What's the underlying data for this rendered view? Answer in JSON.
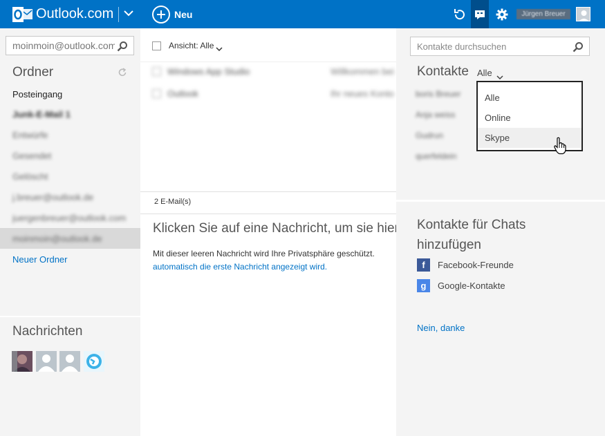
{
  "topbar": {
    "app_title": "Outlook.com",
    "new_label": "Neu",
    "user_name": "Jürgen Breuer",
    "icons": [
      "outlook-logo-icon",
      "chevron-down-icon",
      "plus-circle-icon",
      "undo-icon",
      "chat-icon",
      "gear-icon",
      "avatar"
    ],
    "colors": {
      "bar": "#0072c6",
      "active": "#004e8c"
    }
  },
  "left": {
    "search_value": "moinmoin@outlook.com",
    "folders_title": "Ordner",
    "folders": [
      {
        "label": "Posteingang"
      },
      {
        "label": "Junk-E-Mail 1"
      },
      {
        "label": "Entwürfe"
      },
      {
        "label": "Gesendet"
      },
      {
        "label": "Gelöscht"
      },
      {
        "label": "j.breuer@outlook.de"
      },
      {
        "label": "juergenbreuer@outlook.com"
      },
      {
        "label": "moinmoin@outlook.de"
      }
    ],
    "new_folder": "Neuer Ordner",
    "messages_title": "Nachrichten"
  },
  "middle": {
    "view_label": "Ansicht: Alle",
    "mails": [
      {
        "from": "Windows App Studio",
        "subject": "Willkommen bei"
      },
      {
        "from": "Outlook",
        "subject": "Ihr neues Konto"
      }
    ],
    "count": "2 E-Mail(s)",
    "headline": "Klicken Sie auf eine Nachricht, um sie hier anzuzeigen",
    "info_line1": "Mit dieser leeren Nachricht wird Ihre Privatsphäre geschützt.",
    "info_link": "automatisch die erste Nachricht angezeigt wird."
  },
  "right": {
    "search_placeholder": "Kontakte durchsuchen",
    "contacts_title": "Kontakte",
    "filter_label": "Alle",
    "contacts": [
      "boris Breuer",
      "Anja weiss",
      "Gudrun",
      "querfeldein"
    ],
    "filter_options": [
      "Alle",
      "Online",
      "Skype"
    ],
    "hovered_option": "Skype",
    "chats_title": "Kontakte für Chats hinzufügen",
    "facebook": "Facebook-Freunde",
    "google": "Google-Kontakte",
    "no_thanks": "Nein, danke",
    "colors": {
      "facebook": "#3b5998",
      "google": "#4a86e8",
      "link": "#0072c6"
    }
  }
}
